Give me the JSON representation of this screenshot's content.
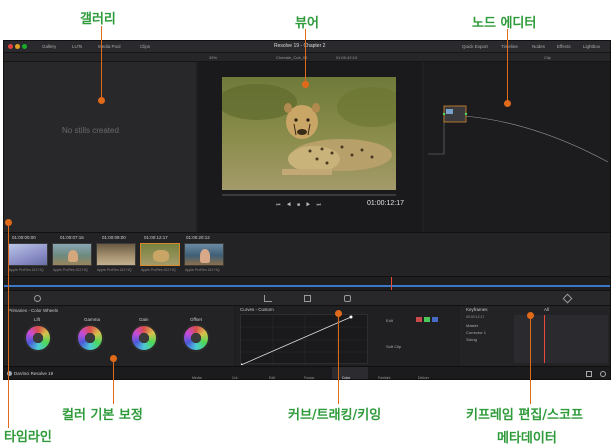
{
  "callouts": {
    "gallery": "갤러리",
    "viewer": "뷰어",
    "node_editor": "노드 에디터",
    "timeline": "타임라인",
    "color_wheels": "컬러 기본 보정",
    "curves": "커브/트래킹/키잉",
    "keyframes_line1": "키프레임 편집/스코프",
    "keyframes_line2": "메타데이터"
  },
  "app": {
    "window_title": "Resolve 19 - Chapter 2",
    "topbar_tabs": [
      "Gallery",
      "LUTs",
      "Media Pool",
      "Clips"
    ],
    "topbar_right": [
      "Quick Export",
      "Timeline",
      "Nodes",
      "Effects",
      "Lightbox"
    ],
    "viewer_zoom": "39%",
    "viewer_clip_name": "Cheetah_Cub_09",
    "viewer_header_tc": "01:00:42:19",
    "viewer_timecode": "01:00:12:17",
    "gallery_empty_text": "No stills created",
    "clip_label": "Clip"
  },
  "clips": [
    {
      "tc": "01:00:00:00",
      "cap": "Apple ProRes 422 HQ"
    },
    {
      "tc": "01:00:07:16",
      "cap": "Apple ProRes 422 HQ"
    },
    {
      "tc": "01:00:09:00",
      "cap": "Apple ProRes 422 HQ"
    },
    {
      "tc": "01:00:12:17",
      "cap": "Apple ProRes 422 HQ"
    },
    {
      "tc": "01:00:20:12",
      "cap": "Apple ProRes 422 HQ"
    }
  ],
  "color_panel": {
    "title": "Primaries - Color Wheels",
    "wheels": [
      "Lift",
      "Gamma",
      "Gain",
      "Offset"
    ]
  },
  "curves_panel": {
    "title": "Curves - Custom",
    "edit_label": "Edit",
    "soft_clip_label": "Soft Clip"
  },
  "keyframes_panel": {
    "title": "Keyframes",
    "filter": "All",
    "tc": "00:00:12:17",
    "rows": [
      "Master",
      "Corrector 1",
      "Sizing"
    ]
  },
  "pagebar": {
    "app_name": "DaVinci Resolve 19",
    "tabs": [
      "Media",
      "Cut",
      "Edit",
      "Fusion",
      "Color",
      "Fairlight",
      "Deliver"
    ],
    "active": "Color"
  }
}
